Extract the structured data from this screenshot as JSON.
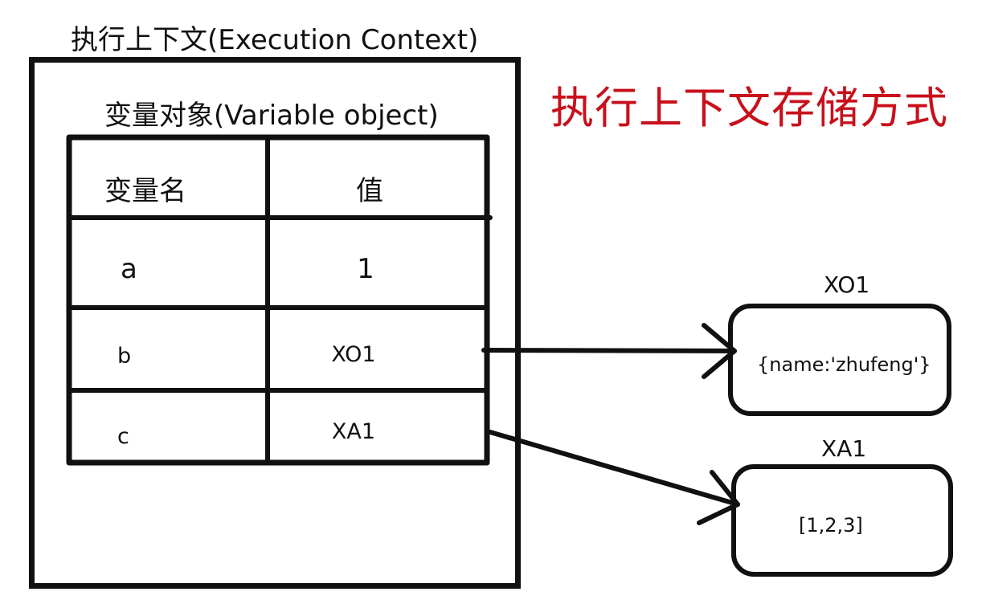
{
  "execution_context": {
    "title": "执行上下文(Execution Context)",
    "variable_object": {
      "title": "变量对象(Variable object)",
      "headers": {
        "name": "变量名",
        "value": "值"
      },
      "rows": [
        {
          "name": "a",
          "value": "1"
        },
        {
          "name": "b",
          "value": "XO1"
        },
        {
          "name": "c",
          "value": "XA1"
        }
      ]
    }
  },
  "caption": "执行上下文存储方式",
  "heap_objects": [
    {
      "label": "XO1",
      "content": "{name:'zhufeng'}"
    },
    {
      "label": "XA1",
      "content": "[1,2,3]"
    }
  ],
  "colors": {
    "stroke": "#111111",
    "caption": "#c8101b"
  }
}
